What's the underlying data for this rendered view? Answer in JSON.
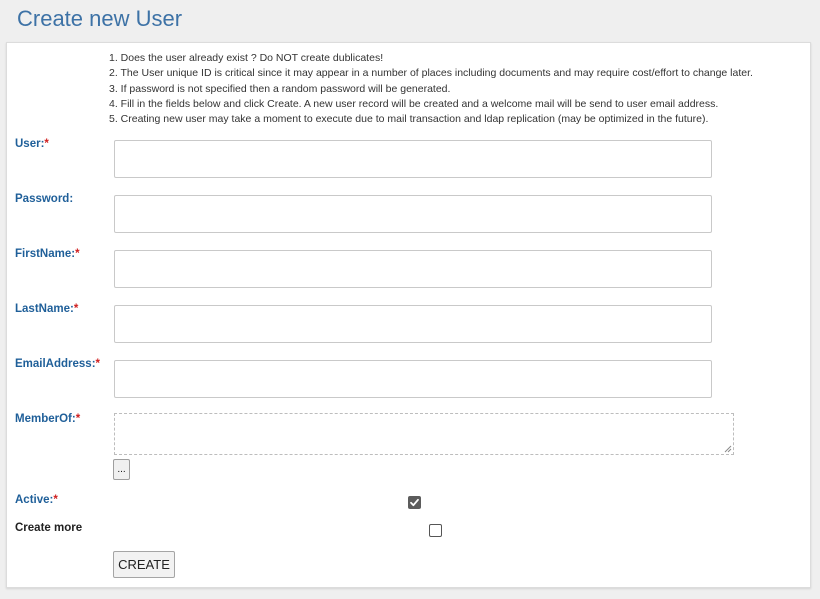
{
  "page": {
    "title": "Create new User"
  },
  "notes": [
    "1. Does the user already exist ? Do NOT create dublicates!",
    "2. The User unique ID is critical since it may appear in a number of places including documents and may require cost/effort to change later.",
    "3. If password is not specified then a random password will be generated.",
    "4. Fill in the fields below and click Create. A new user record will be created and a welcome mail will be send to user email address.",
    "5. Creating new user may take a moment to execute due to mail transaction and ldap replication (may be optimized in the future)."
  ],
  "form": {
    "required_marker": "*",
    "user": {
      "label": "User:",
      "value": ""
    },
    "password": {
      "label": "Password:",
      "value": ""
    },
    "firstname": {
      "label": "FirstName:",
      "value": ""
    },
    "lastname": {
      "label": "LastName:",
      "value": ""
    },
    "email": {
      "label": "EmailAddress:",
      "value": ""
    },
    "memberof": {
      "label": "MemberOf:",
      "browse_label": "..."
    },
    "active": {
      "label": "Active:",
      "checked": true
    },
    "create_more": {
      "label": "Create more",
      "checked": false
    },
    "submit_label": "CREATE"
  },
  "colors": {
    "title": "#3d72a6",
    "label": "#1f5f99",
    "required": "#d02020",
    "checkbox_checked": "#5c5c5c"
  },
  "icons": {
    "active": "check-icon",
    "memberof": "resize-grip-icon"
  }
}
